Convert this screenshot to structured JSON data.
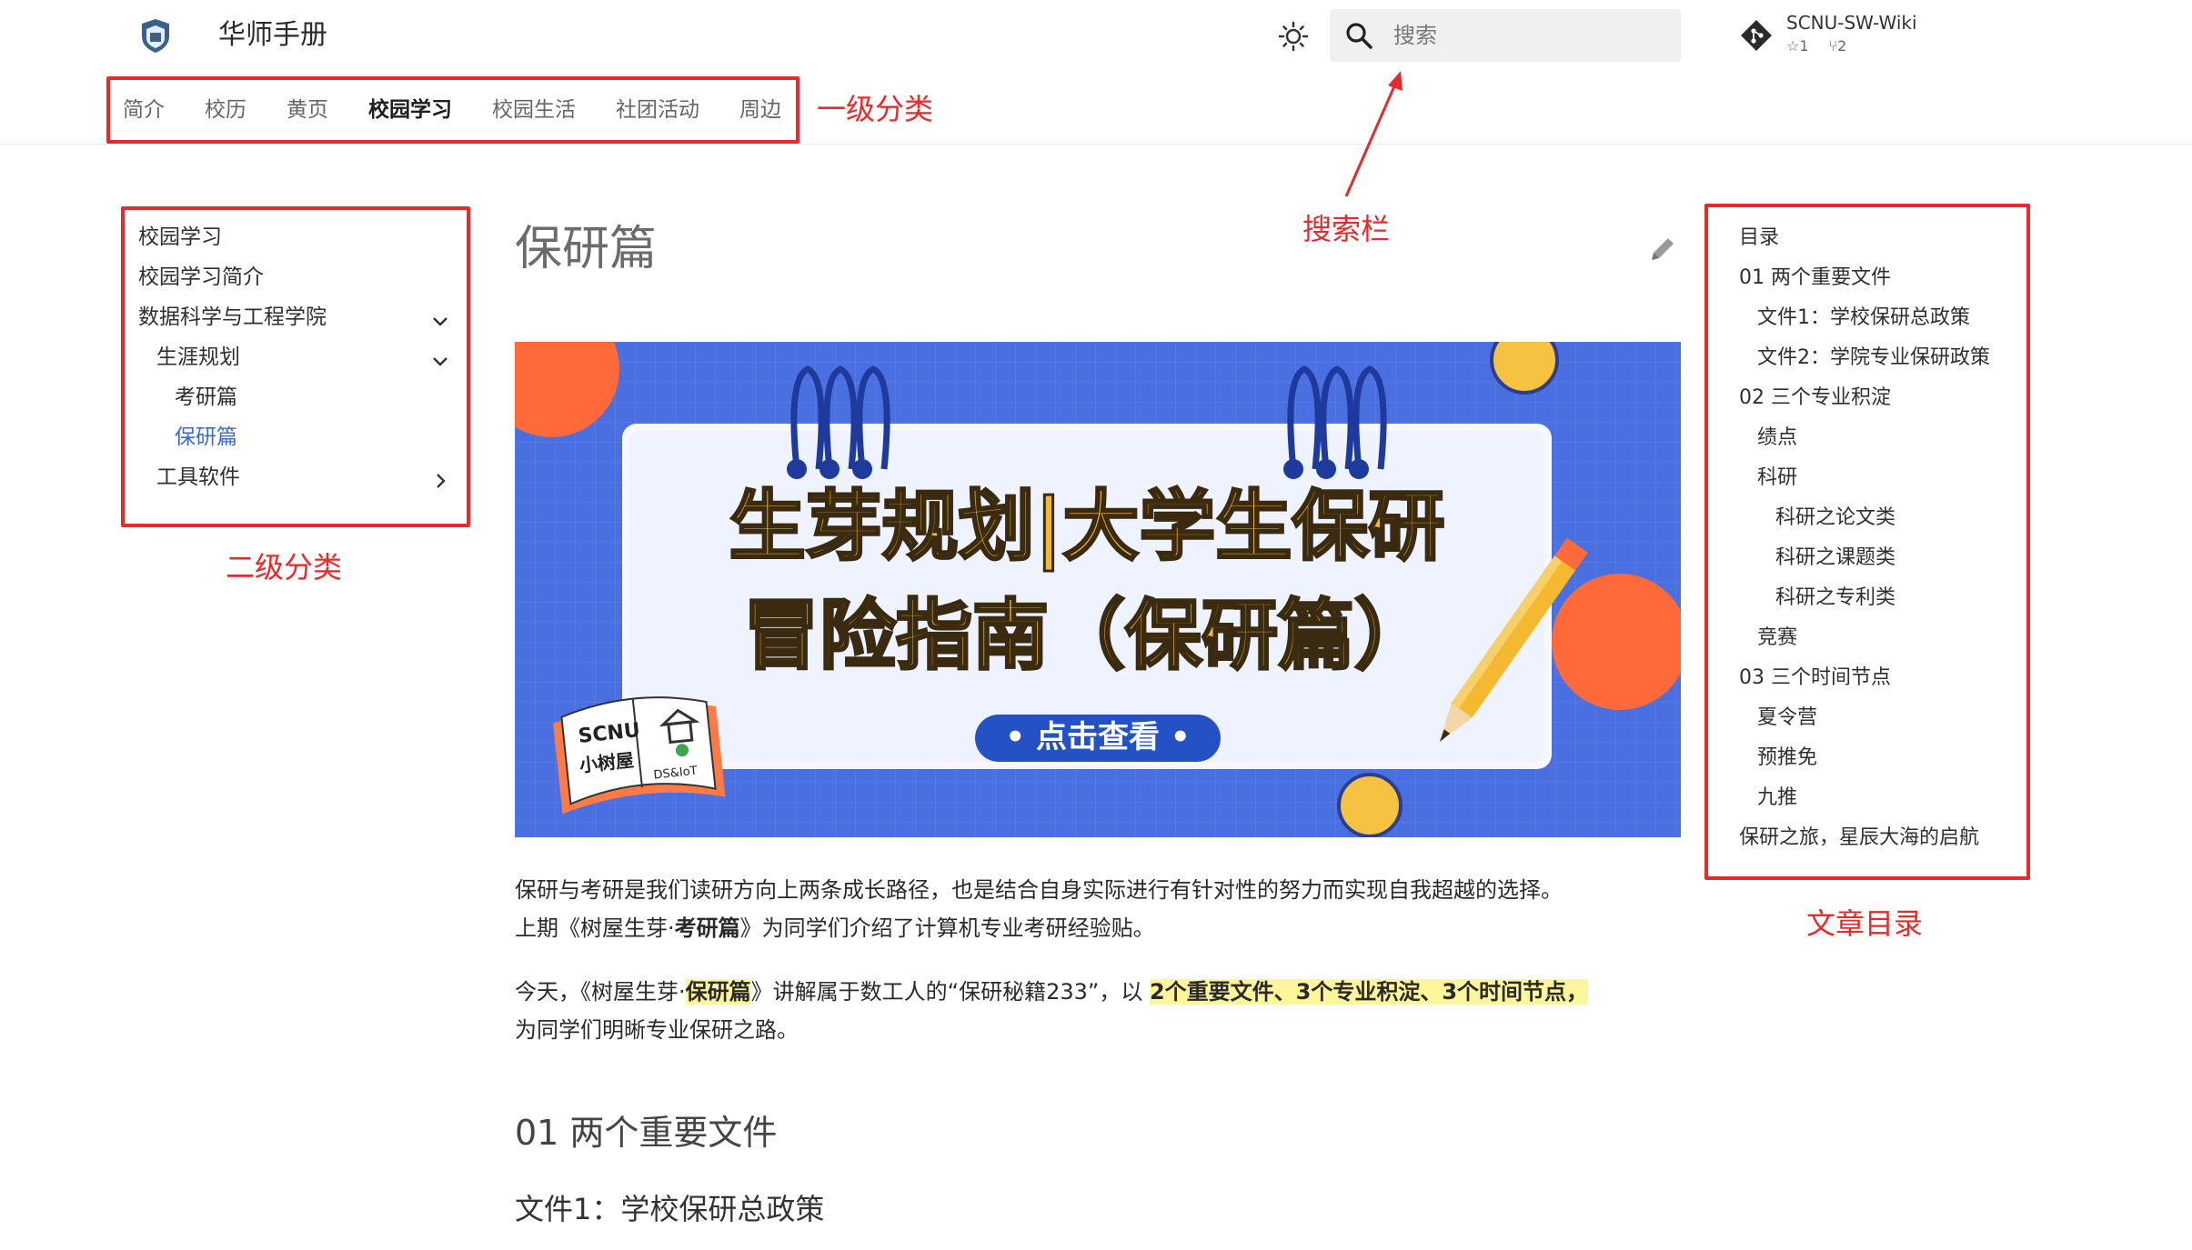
{
  "header": {
    "site_title": "华师手册",
    "tabs": [
      "简介",
      "校历",
      "黄页",
      "校园学习",
      "校园生活",
      "社团活动",
      "周边"
    ],
    "active_tab": 3,
    "search_placeholder": "搜索",
    "repo": {
      "name": "SCNU-SW-Wiki",
      "stars": "1",
      "forks": "2"
    }
  },
  "annotations": {
    "level1": "一级分类",
    "search": "搜索栏",
    "level2": "二级分类",
    "toc": "文章目录"
  },
  "sidebar": {
    "items": [
      {
        "label": "校园学习",
        "level": 0,
        "chevron": ""
      },
      {
        "label": "校园学习简介",
        "level": 0,
        "chevron": ""
      },
      {
        "label": "数据科学与工程学院",
        "level": 0,
        "chevron": "down"
      },
      {
        "label": "生涯规划",
        "level": 1,
        "chevron": "down"
      },
      {
        "label": "考研篇",
        "level": 2,
        "chevron": ""
      },
      {
        "label": "保研篇",
        "level": 2,
        "chevron": "",
        "active": true
      },
      {
        "label": "工具软件",
        "level": 1,
        "chevron": "right"
      }
    ]
  },
  "article": {
    "title": "保研篇",
    "banner": {
      "line1": "生芽规划|大学生保研",
      "line2": "冒险指南（保研篇）",
      "button": "• 点击查看 •",
      "book_text1": "SCNU",
      "book_text2": "小树屋",
      "book_text3": "DS&IoT"
    },
    "p1_line1": "保研与考研是我们读研方向上两条成长路径，也是结合自身实际进行有针对性的努力而实现自我超越的选择。",
    "p1_line2_a": "上期《树屋生芽·",
    "p1_line2_b": "考研篇",
    "p1_line2_c": "》为同学们介绍了计算机专业考研经验贴。",
    "p2_a": "今天，《树屋生芽·",
    "p2_b": "保研篇",
    "p2_c": "》讲解属于数工人的“保研秘籍233”，以 ",
    "p2_d": "2个重要文件、3个专业积淀、3个时间节点，",
    "p2_line2": "为同学们明晰专业保研之路。",
    "h2": "01 两个重要文件",
    "h3": "文件1：学校保研总政策"
  },
  "toc": {
    "title": "目录",
    "items": [
      {
        "label": "01 两个重要文件",
        "level": 0
      },
      {
        "label": "文件1：学校保研总政策",
        "level": 1
      },
      {
        "label": "文件2：学院专业保研政策",
        "level": 1
      },
      {
        "label": "02 三个专业积淀",
        "level": 0
      },
      {
        "label": "绩点",
        "level": 1
      },
      {
        "label": "科研",
        "level": 1
      },
      {
        "label": "科研之论文类",
        "level": 2
      },
      {
        "label": "科研之课题类",
        "level": 2
      },
      {
        "label": "科研之专利类",
        "level": 2
      },
      {
        "label": "竞赛",
        "level": 1
      },
      {
        "label": "03 三个时间节点",
        "level": 0
      },
      {
        "label": "夏令营",
        "level": 1
      },
      {
        "label": "预推免",
        "level": 1
      },
      {
        "label": "九推",
        "level": 1
      },
      {
        "label": "保研之旅，星辰大海的启航",
        "level": 0
      }
    ]
  },
  "colors": {
    "annotation_red": "#e52b2b",
    "active_link": "#3a6bd4",
    "highlight": "#fff59a",
    "banner_blue": "#4a6fe0",
    "banner_yellow": "#f5c242"
  }
}
